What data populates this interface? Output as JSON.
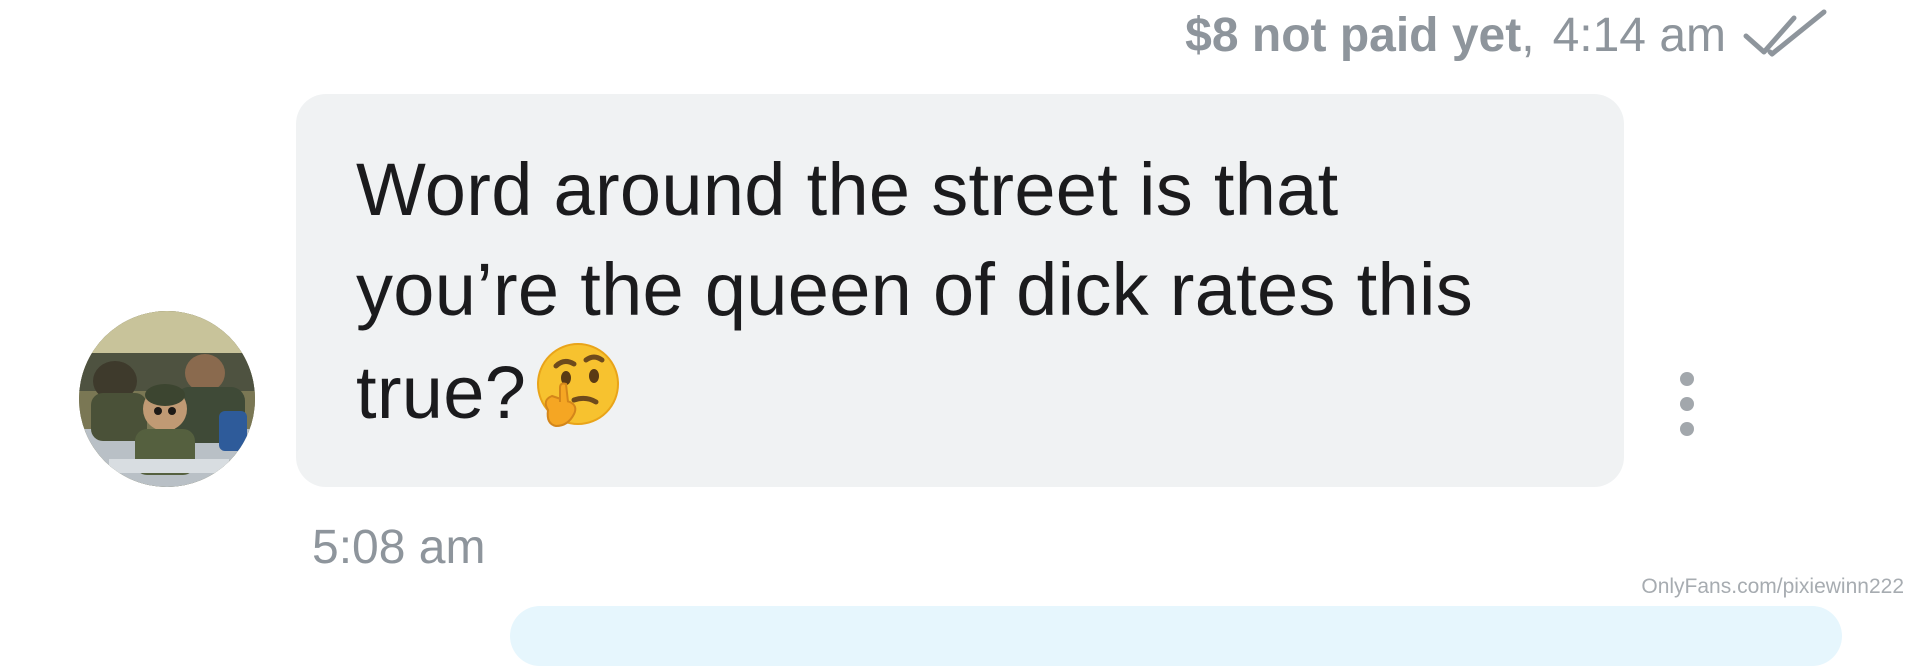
{
  "message_meta": {
    "price_status": "$8 not paid yet",
    "separator": ",",
    "sent_time": "4:14 am",
    "read_receipt_icon": "double-check-icon"
  },
  "incoming_message": {
    "lines": [
      "Word around the street is that",
      "you’re the queen of dick rates this",
      "true?"
    ],
    "emoji": "thinking-face-emoji",
    "timestamp": "5:08 am"
  },
  "avatar": {
    "icon": "avatar-photo"
  },
  "message_actions": {
    "icon": "vertical-ellipsis-icon"
  },
  "watermark": "OnlyFans.com/pixiewinn222",
  "colors": {
    "incoming_bubble": "#f0f2f3",
    "outgoing_bubble": "#e6f6fd",
    "meta_text": "#8e959c",
    "message_text": "#1b1b1d",
    "emoji_face": "#f7c22f"
  }
}
